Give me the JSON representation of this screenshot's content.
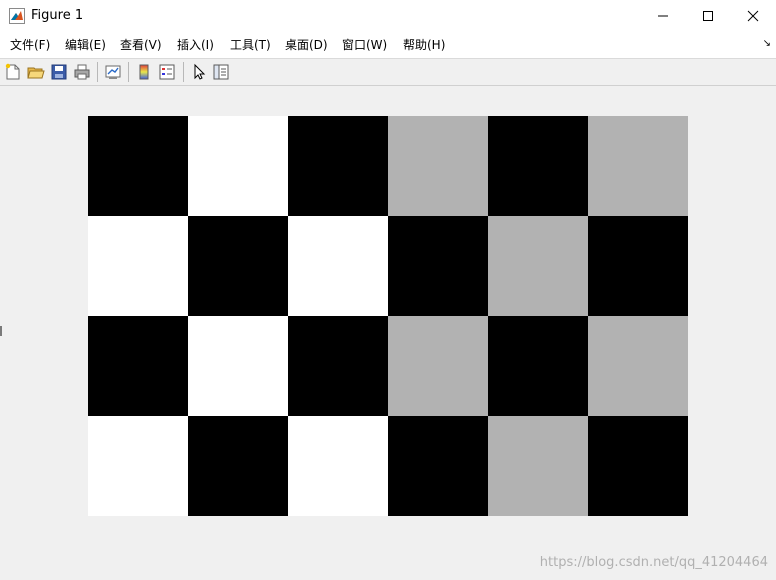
{
  "window": {
    "title": "Figure 1",
    "minimize_glyph": "—",
    "maximize_glyph": "☐",
    "close_glyph": "✕"
  },
  "menu": {
    "items": [
      {
        "label": "文件(F)"
      },
      {
        "label": "编辑(E)"
      },
      {
        "label": "查看(V)"
      },
      {
        "label": "插入(I)"
      },
      {
        "label": "工具(T)"
      },
      {
        "label": "桌面(D)"
      },
      {
        "label": "窗口(W)"
      },
      {
        "label": "帮助(H)"
      }
    ],
    "corner_glyph": "↘"
  },
  "toolbar": {
    "icons": [
      "new-figure-icon",
      "open-file-icon",
      "save-icon",
      "print-icon",
      "link-plot-icon",
      "colorbar-icon",
      "legend-icon",
      "pointer-icon",
      "property-inspector-icon"
    ]
  },
  "checkerboard": {
    "rows": 4,
    "cols": 6,
    "colors": {
      "black": "#000000",
      "white": "#ffffff",
      "gray": "#b2b2b2"
    },
    "cells": [
      [
        "black",
        "white",
        "black",
        "gray",
        "black",
        "gray"
      ],
      [
        "white",
        "black",
        "white",
        "black",
        "gray",
        "black"
      ],
      [
        "black",
        "white",
        "black",
        "gray",
        "black",
        "gray"
      ],
      [
        "white",
        "black",
        "white",
        "black",
        "gray",
        "black"
      ]
    ]
  },
  "watermark": "https://blog.csdn.net/qq_41204464"
}
